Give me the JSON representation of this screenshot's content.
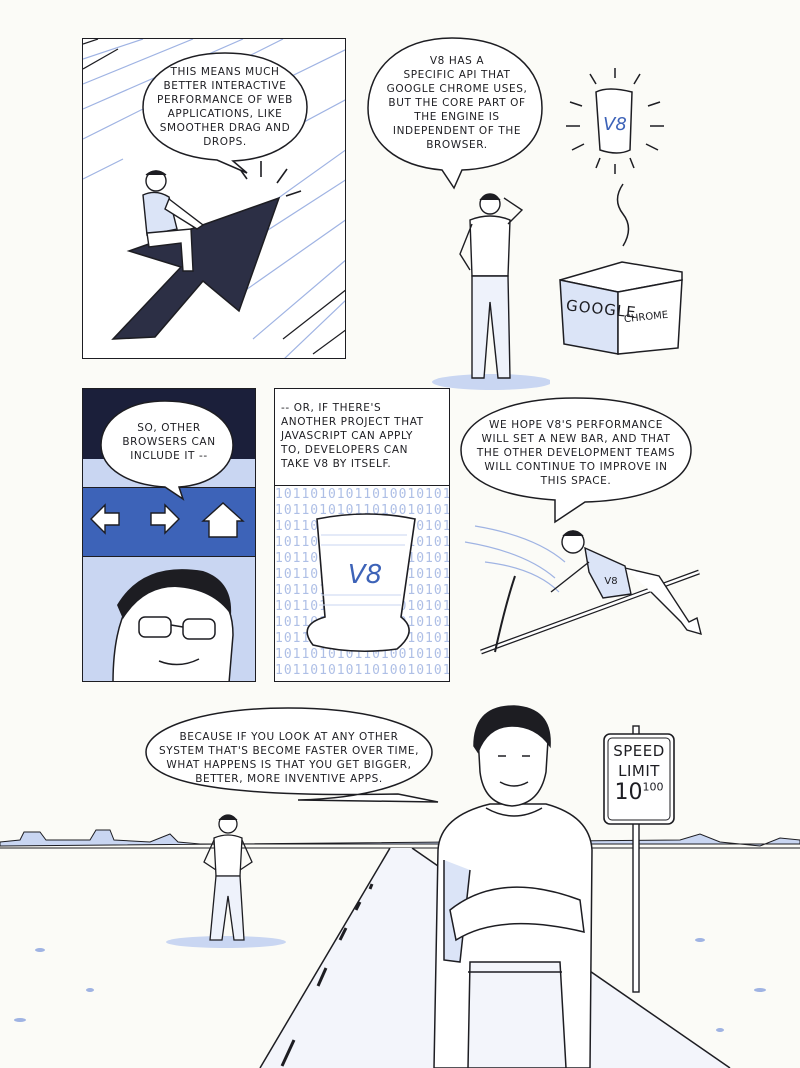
{
  "panels": [
    {
      "id": "p1",
      "speech": [
        "THIS MEANS MUCH",
        "BETTER INTERACTIVE",
        "PERFORMANCE OF WEB",
        "APPLICATIONS, LIKE",
        "SMOOTHER DRAG AND",
        "DROPS."
      ]
    },
    {
      "id": "p2",
      "speech": [
        "V8 HAS A",
        "SPECIFIC API THAT",
        "GOOGLE CHROME USES,",
        "BUT THE CORE PART OF",
        "THE ENGINE IS",
        "INDEPENDENT OF THE",
        "BROWSER."
      ],
      "scroll_label": "V8",
      "box_label_front": "GOOGLE",
      "box_label_side": "CHROME"
    },
    {
      "id": "p3",
      "speech": [
        "SO, OTHER",
        "BROWSERS CAN",
        "INCLUDE IT --"
      ]
    },
    {
      "id": "p4",
      "caption": [
        "-- OR, IF THERE'S",
        "ANOTHER PROJECT THAT",
        "JAVASCRIPT CAN APPLY",
        "TO, DEVELOPERS CAN",
        "TAKE V8 BY ITSELF."
      ],
      "scroll_label": "V8",
      "binary": "1011010101101001010110"
    },
    {
      "id": "p5",
      "speech": [
        "WE HOPE V8'S PERFORMANCE",
        "WILL SET A NEW BAR, AND THAT",
        "THE OTHER DEVELOPMENT TEAMS",
        "WILL CONTINUE TO IMPROVE IN",
        "THIS SPACE."
      ],
      "shirt_label": "V8"
    },
    {
      "id": "p6",
      "speech": [
        "BECAUSE IF YOU LOOK AT ANY OTHER",
        "SYSTEM THAT'S BECOME FASTER OVER TIME,",
        "WHAT HAPPENS IS THAT YOU GET BIGGER,",
        "BETTER, MORE INVENTIVE APPS."
      ],
      "sign": {
        "line1": "SPEED",
        "line2": "LIMIT",
        "value": "10",
        "exponent": "100"
      }
    }
  ],
  "colors": {
    "ink": "#1d1d22",
    "blue": "#3d63b8",
    "light_blue": "#c9d6f2",
    "navy": "#1b1f3a",
    "paper": "#fbfbf7"
  }
}
